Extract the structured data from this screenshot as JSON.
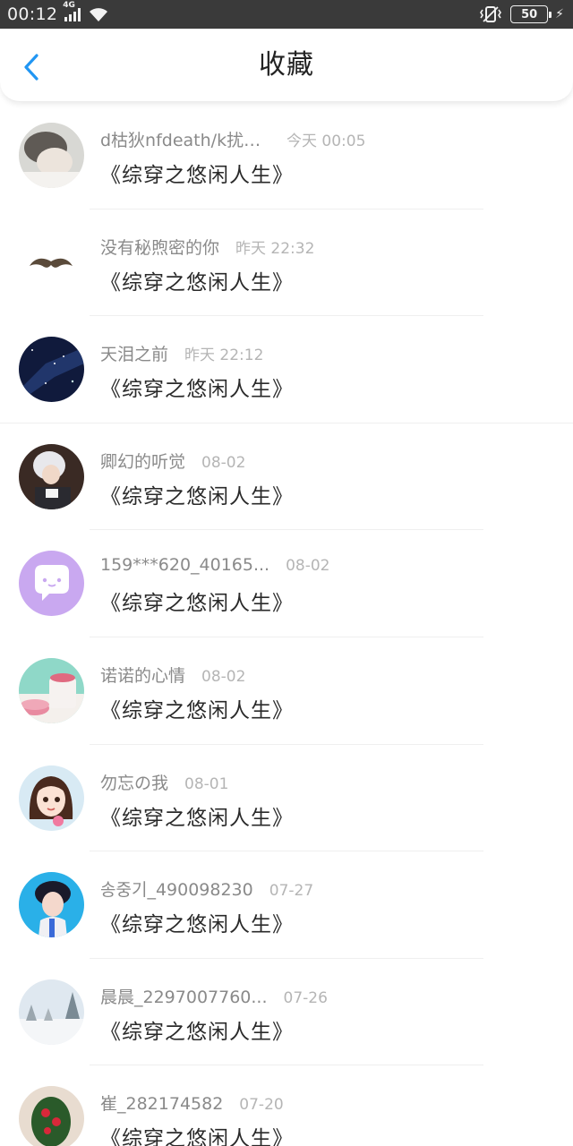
{
  "status_bar": {
    "time": "00:12",
    "network": "4G",
    "battery": "50",
    "icons": [
      "signal-icon",
      "wifi-icon",
      "vibrate-icon",
      "battery-icon",
      "charging-icon"
    ]
  },
  "header": {
    "title": "收藏",
    "back_icon": "chevron-left-icon"
  },
  "colors": {
    "accent": "#2196f3",
    "name_text": "#8a8a8a",
    "time_text": "#b5b5b5",
    "title_text": "#2a2a2a"
  },
  "items": [
    {
      "name": "d枯狄nfdeath/k扰n...",
      "time": "今天 00:05",
      "title": "《综穿之悠闲人生》",
      "avatar": "avatar-sleeping-child"
    },
    {
      "name": "没有秘煦密的你",
      "time": "昨天 22:32",
      "title": "《综穿之悠闲人生》",
      "avatar": "avatar-mustache"
    },
    {
      "name": "天泪之前",
      "time": "昨天 22:12",
      "title": "《综穿之悠闲人生》",
      "avatar": "avatar-night-sky"
    },
    {
      "name": "卿幻的听觉",
      "time": "08-02",
      "title": "《综穿之悠闲人生》",
      "avatar": "avatar-anime-white-hair"
    },
    {
      "name": "159***620_40165...",
      "time": "08-02",
      "title": "《综穿之悠闲人生》",
      "avatar": "avatar-chat-bubble"
    },
    {
      "name": "诺诺的心情",
      "time": "08-02",
      "title": "《综穿之悠闲人生》",
      "avatar": "avatar-macarons"
    },
    {
      "name": "勿忘の我",
      "time": "08-01",
      "title": "《综穿之悠闲人生》",
      "avatar": "avatar-cartoon-girl"
    },
    {
      "name": "송중기_490098230",
      "time": "07-27",
      "title": "《综穿之悠闲人生》",
      "avatar": "avatar-anime-boy"
    },
    {
      "name": "晨晨_2297007760...",
      "time": "07-26",
      "title": "《综穿之悠闲人生》",
      "avatar": "avatar-snow-trees"
    },
    {
      "name": "崔_282174582",
      "time": "07-20",
      "title": "《综穿之悠闲人生》",
      "avatar": "avatar-flowers"
    }
  ]
}
